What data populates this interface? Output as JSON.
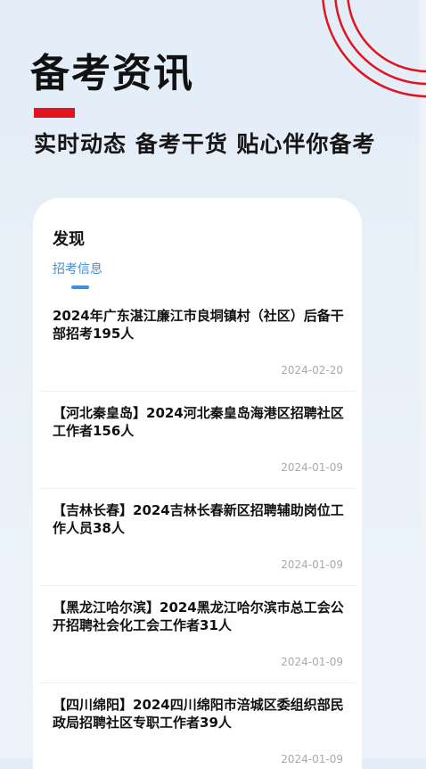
{
  "header": {
    "title": "备考资讯",
    "subtitle": "实时动态  备考干货  贴心伴你备考"
  },
  "card": {
    "heading": "发现",
    "tab": "招考信息",
    "items": [
      {
        "title": "2024年广东湛江廉江市良垌镇村（社区）后备干部招考195人",
        "date": "2024-02-20"
      },
      {
        "title": "【河北秦皇岛】2024河北秦皇岛海港区招聘社区工作者156人",
        "date": "2024-01-09"
      },
      {
        "title": "【吉林长春】2024吉林长春新区招聘辅助岗位工作人员38人",
        "date": "2024-01-09"
      },
      {
        "title": "【黑龙江哈尔滨】2024黑龙江哈尔滨市总工会公开招聘社会化工会工作者31人",
        "date": "2024-01-09"
      },
      {
        "title": "【四川绵阳】2024四川绵阳市涪城区委组织部民政局招聘社区专职工作者39人",
        "date": "2024-01-09"
      }
    ]
  },
  "colors": {
    "accent_red": "#e0141e",
    "tab_blue": "#3d8fe0"
  }
}
